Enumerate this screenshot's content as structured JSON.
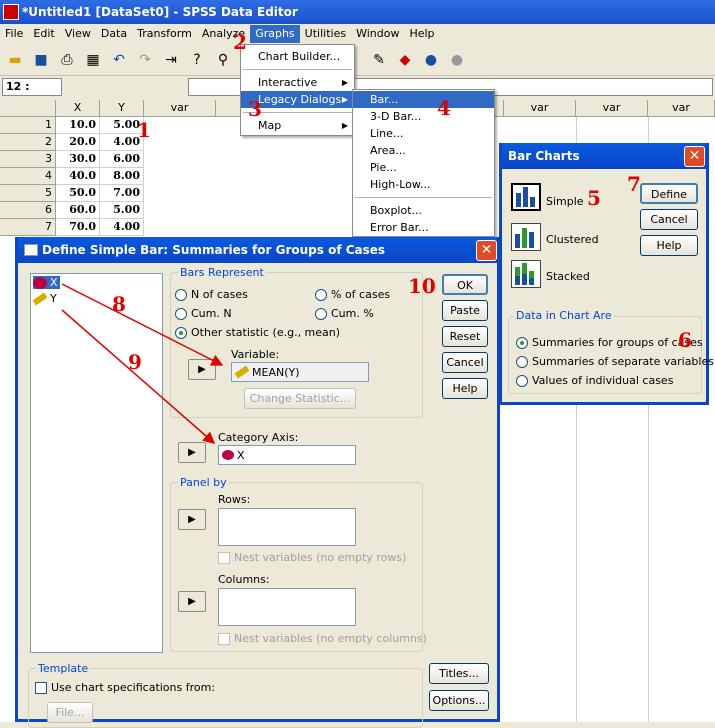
{
  "window": {
    "title": "*Untitled1 [DataSet0] - SPSS Data Editor"
  },
  "menubar": [
    "File",
    "Edit",
    "View",
    "Data",
    "Transform",
    "Analyze",
    "Graphs",
    "Utilities",
    "Window",
    "Help"
  ],
  "cellbar": {
    "ref": "12 :"
  },
  "grid": {
    "columns": [
      "X",
      "Y",
      "var",
      "var",
      "var",
      "var",
      "var",
      "var",
      "var",
      "var"
    ],
    "rows": [
      {
        "n": "1",
        "x": "10.0",
        "y": "5.00"
      },
      {
        "n": "2",
        "x": "20.0",
        "y": "4.00"
      },
      {
        "n": "3",
        "x": "30.0",
        "y": "6.00"
      },
      {
        "n": "4",
        "x": "40.0",
        "y": "8.00"
      },
      {
        "n": "5",
        "x": "50.0",
        "y": "7.00"
      },
      {
        "n": "6",
        "x": "60.0",
        "y": "5.00"
      },
      {
        "n": "7",
        "x": "70.0",
        "y": "4.00"
      }
    ]
  },
  "graphs_menu": {
    "items": [
      "Chart Builder...",
      "Interactive",
      "Legacy Dialogs",
      "Map"
    ]
  },
  "legacy_menu": {
    "items": [
      "Bar...",
      "3-D Bar...",
      "Line...",
      "Area...",
      "Pie...",
      "High-Low...",
      "Boxplot...",
      "Error Bar..."
    ]
  },
  "bar_charts": {
    "title": "Bar Charts",
    "types": [
      "Simple",
      "Clustered",
      "Stacked"
    ],
    "buttons": {
      "define": "Define",
      "cancel": "Cancel",
      "help": "Help"
    },
    "data_group": "Data in Chart Are",
    "options": [
      "Summaries for groups of cases",
      "Summaries of separate variables",
      "Values of individual cases"
    ]
  },
  "define_dialog": {
    "title": "Define Simple Bar: Summaries for Groups of Cases",
    "variables": [
      "X",
      "Y"
    ],
    "bars_represent": "Bars Represent",
    "opt_n": "N of cases",
    "opt_pct": "% of cases",
    "opt_cumn": "Cum. N",
    "opt_cumpct": "Cum. %",
    "opt_other": "Other statistic (e.g., mean)",
    "variable_label": "Variable:",
    "variable_value": "MEAN(Y)",
    "change_stat": "Change Statistic...",
    "category_label": "Category Axis:",
    "category_value": "X",
    "panel_by": "Panel by",
    "rows_label": "Rows:",
    "nest_rows": "Nest variables (no empty rows)",
    "columns_label": "Columns:",
    "nest_cols": "Nest variables (no empty columns)",
    "template": "Template",
    "use_chart": "Use chart specifications from:",
    "file_btn": "File...",
    "buttons": {
      "ok": "OK",
      "paste": "Paste",
      "reset": "Reset",
      "cancel": "Cancel",
      "help": "Help",
      "titles": "Titles...",
      "options": "Options..."
    }
  },
  "annotations": [
    "1",
    "2",
    "3",
    "4",
    "5",
    "6",
    "7",
    "8",
    "9",
    "10"
  ],
  "colors": {
    "accent": "#316ac5",
    "annotation": "#e00000",
    "titlebar": "#0a46c6"
  }
}
